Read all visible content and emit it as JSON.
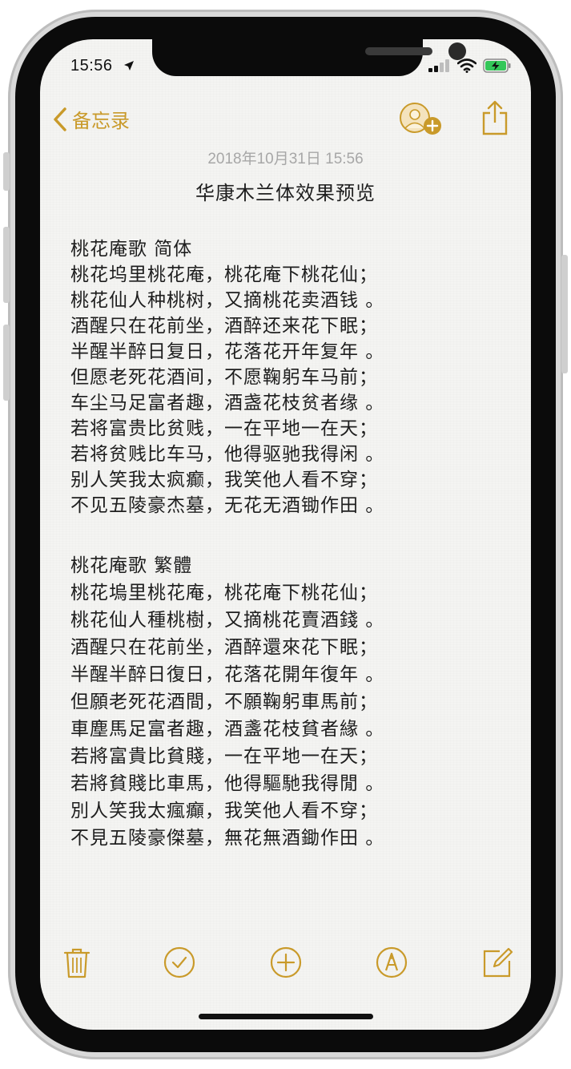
{
  "status_bar": {
    "time": "15:56",
    "icons": [
      "location-arrow-icon",
      "signal-bars-icon",
      "wifi-icon",
      "battery-charging-icon"
    ]
  },
  "nav": {
    "back_label": "备忘录",
    "right_icons": [
      "add-people-icon",
      "share-icon"
    ]
  },
  "note": {
    "date": "2018年10月31日 15:56",
    "title": "华康木兰体效果预览",
    "sections": [
      {
        "heading": "桃花庵歌 简体",
        "lines": [
          "桃花坞里桃花庵，桃花庵下桃花仙；",
          "桃花仙人种桃树，又摘桃花卖酒钱 。",
          "酒醒只在花前坐，酒醉还来花下眠；",
          "半醒半醉日复日，花落花开年复年 。",
          "但愿老死花酒间，不愿鞠躬车马前；",
          "车尘马足富者趣，酒盏花枝贫者缘 。",
          "若将富贵比贫贱，一在平地一在天；",
          "若将贫贱比车马，他得驱驰我得闲 。",
          "别人笑我太疯癫，我笑他人看不穿；",
          "不见五陵豪杰墓，无花无酒锄作田 。"
        ]
      },
      {
        "heading": "桃花庵歌 繁體",
        "lines": [
          "桃花塢里桃花庵，桃花庵下桃花仙；",
          "桃花仙人種桃樹，又摘桃花賣酒錢 。",
          "酒醒只在花前坐，酒醉還來花下眠；",
          "半醒半醉日復日，花落花開年復年 。",
          "但願老死花酒間，不願鞠躬車馬前；",
          "車塵馬足富者趣，酒盞花枝貧者緣 。",
          "若將富貴比貧賤，一在平地一在天；",
          "若將貧賤比車馬，他得驅馳我得閒 。",
          "別人笑我太瘋癲，我笑他人看不穿；",
          "不見五陵豪傑墓，無花無酒鋤作田 。"
        ]
      }
    ]
  },
  "toolbar": {
    "icons": [
      "trash-icon",
      "checklist-icon",
      "add-icon",
      "markup-pen-icon",
      "compose-icon"
    ]
  },
  "colors": {
    "accent": "#c99a2a",
    "paper": "#f4f4f2",
    "text": "#1e1e1e",
    "date_text": "#a7a7a7",
    "battery": "#34c759"
  }
}
